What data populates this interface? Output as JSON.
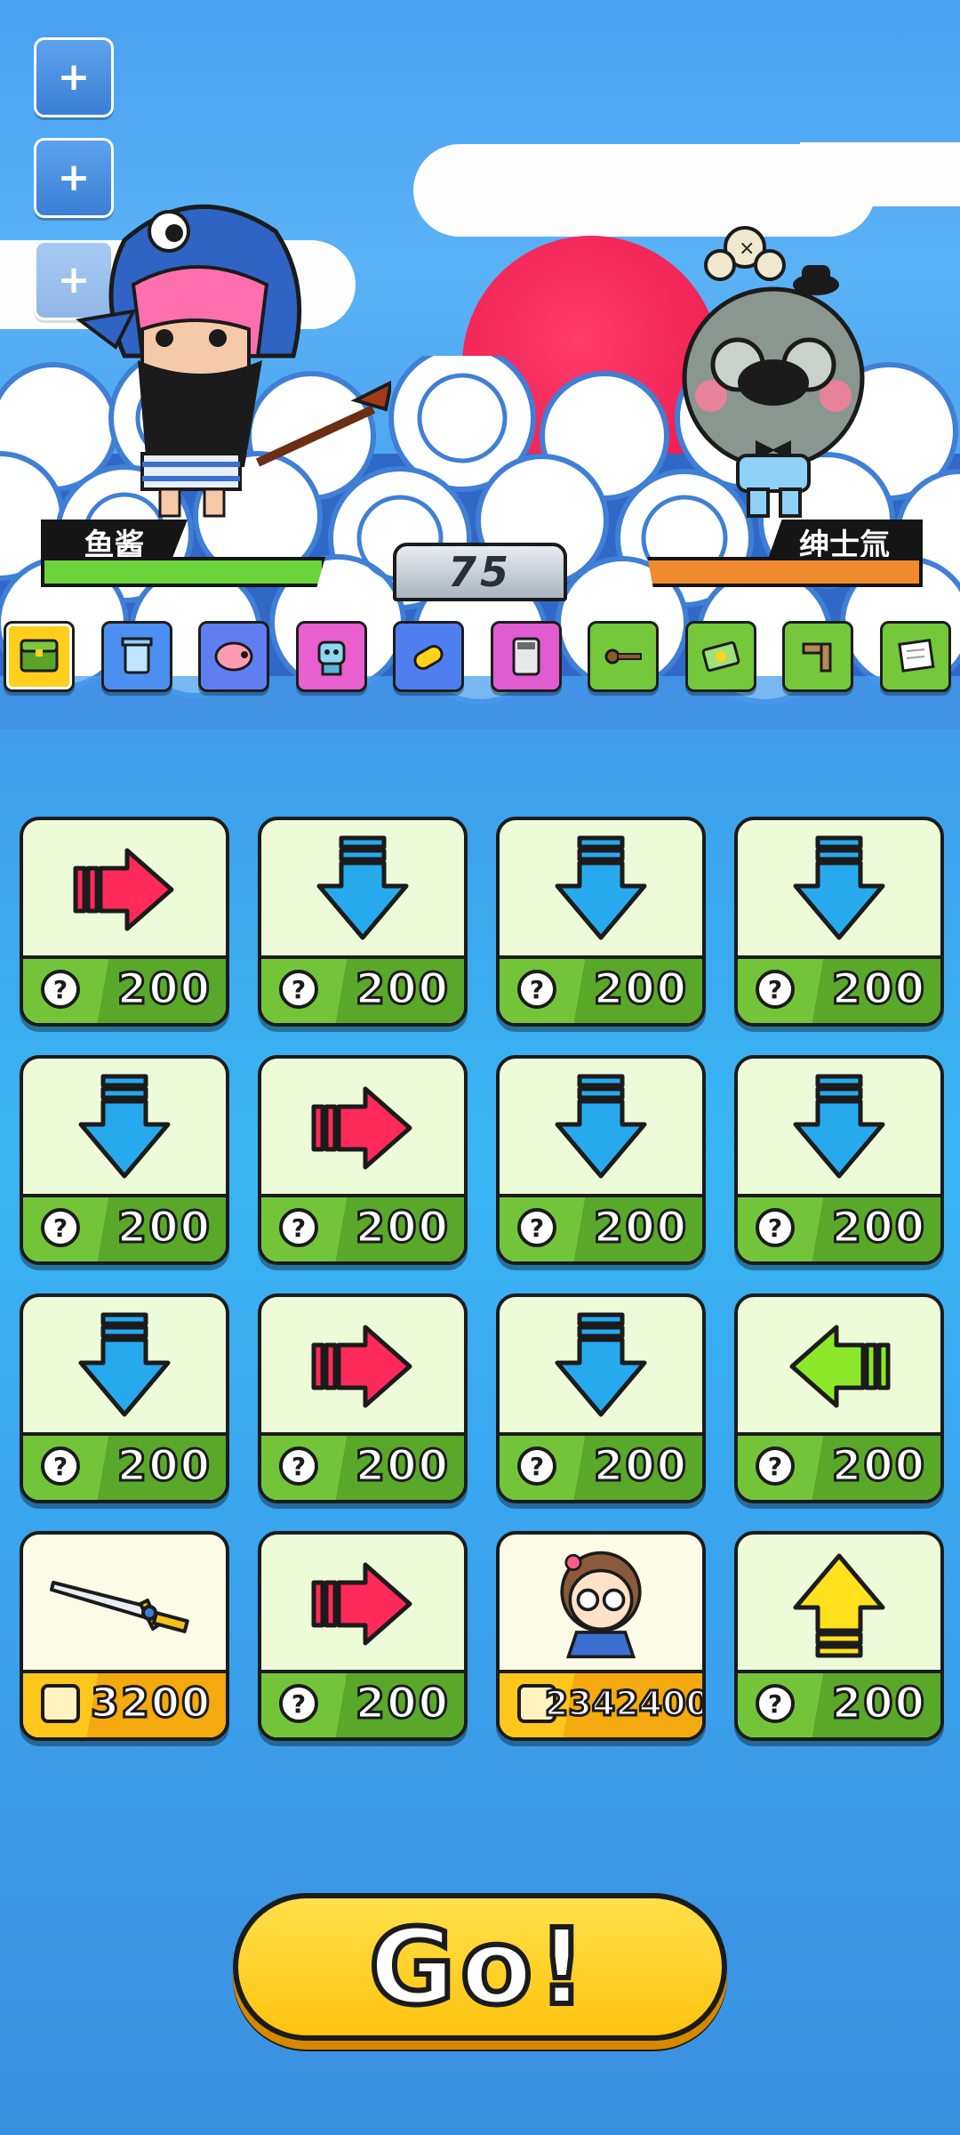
{
  "hud": {
    "side_buttons": [
      {
        "icon": "plus-icon",
        "symbol": "+"
      },
      {
        "icon": "plus-icon",
        "symbol": "+"
      },
      {
        "icon": "plus-icon",
        "symbol": "+"
      }
    ]
  },
  "player": {
    "name": "鱼酱",
    "hp_fraction": 1.0,
    "hp_color": "#6ad43a"
  },
  "enemy": {
    "name": "绅士氚",
    "hp_fraction": 1.0,
    "hp_color": "#f08a2e"
  },
  "round": {
    "value": "75"
  },
  "items": [
    {
      "icon": "green-chest-icon",
      "bg": "#ffcf1c"
    },
    {
      "icon": "recycle-bin-icon",
      "bg": "#4b8ff0"
    },
    {
      "icon": "piggy-bank-icon",
      "bg": "#5f7ef0"
    },
    {
      "icon": "robot-icon",
      "bg": "#e85fd0"
    },
    {
      "icon": "capsule-icon",
      "bg": "#4f7ef0"
    },
    {
      "icon": "calculator-icon",
      "bg": "#e05bd0"
    },
    {
      "icon": "key-icon",
      "bg": "#74c83a"
    },
    {
      "icon": "money-icon",
      "bg": "#74c83a"
    },
    {
      "icon": "hinge-icon",
      "bg": "#74c83a"
    },
    {
      "icon": "paper-icon",
      "bg": "#74c83a"
    }
  ],
  "cards": [
    {
      "kind": "arrow",
      "dir": "right",
      "cost": "200",
      "color": "#ff2a5a"
    },
    {
      "kind": "arrow",
      "dir": "down",
      "cost": "200",
      "color": "#27a9ee"
    },
    {
      "kind": "arrow",
      "dir": "down",
      "cost": "200",
      "color": "#27a9ee"
    },
    {
      "kind": "arrow",
      "dir": "down",
      "cost": "200",
      "color": "#27a9ee"
    },
    {
      "kind": "arrow",
      "dir": "down",
      "cost": "200",
      "color": "#27a9ee"
    },
    {
      "kind": "arrow",
      "dir": "right",
      "cost": "200",
      "color": "#ff2a5a"
    },
    {
      "kind": "arrow",
      "dir": "down",
      "cost": "200",
      "color": "#27a9ee"
    },
    {
      "kind": "arrow",
      "dir": "down",
      "cost": "200",
      "color": "#27a9ee"
    },
    {
      "kind": "arrow",
      "dir": "down",
      "cost": "200",
      "color": "#27a9ee"
    },
    {
      "kind": "arrow",
      "dir": "right",
      "cost": "200",
      "color": "#ff2a5a"
    },
    {
      "kind": "arrow",
      "dir": "down",
      "cost": "200",
      "color": "#27a9ee"
    },
    {
      "kind": "arrow",
      "dir": "left",
      "cost": "200",
      "color": "#8ee82a"
    },
    {
      "kind": "sword",
      "cost": "3200",
      "footer": "gold",
      "footer_icon": "sword-token-icon"
    },
    {
      "kind": "arrow",
      "dir": "right",
      "cost": "200",
      "color": "#ff2a5a"
    },
    {
      "kind": "character",
      "cost": "2342400",
      "footer": "gold",
      "footer_icon": "person-token-icon"
    },
    {
      "kind": "arrow",
      "dir": "up",
      "cost": "200",
      "color": "#ffe11e"
    }
  ],
  "go_button": {
    "label": "Go!"
  }
}
